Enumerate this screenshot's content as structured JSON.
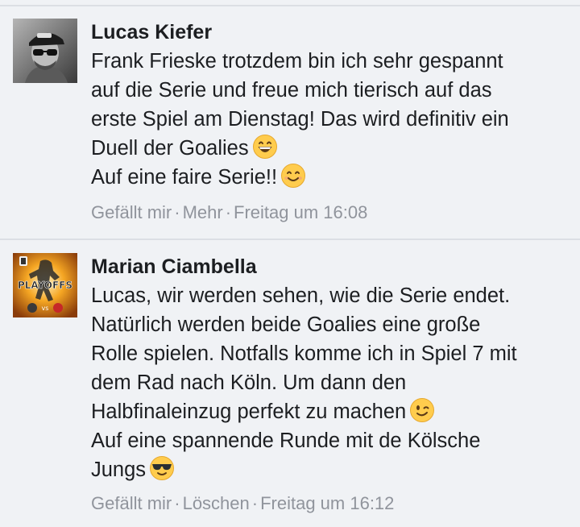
{
  "comments": [
    {
      "author": "Lucas Kiefer",
      "lines": [
        "Frank Frieske trotzdem bin ich sehr gespannt",
        "auf die Serie und freue mich tierisch auf das",
        "erste Spiel am Dienstag! Das wird definitiv ein",
        "Duell der Goalies",
        "Auf eine faire Serie!!"
      ],
      "emojis": [
        "grinning-face-icon",
        "smiling-face-icon"
      ],
      "actions": {
        "like": "Gefällt mir",
        "second": "Mehr",
        "time": "Freitag um 16:08"
      }
    },
    {
      "author": "Marian Ciambella",
      "lines": [
        "Lucas, wir werden sehen, wie die Serie endet.",
        "Natürlich werden beide Goalies eine große",
        "Rolle spielen. Notfalls komme ich in Spiel 7 mit",
        "dem Rad nach Köln. Um dann den",
        "Halbfinaleinzug perfekt zu machen",
        "Auf eine spannende Runde mit de Kölsche",
        "Jungs"
      ],
      "emojis": [
        "winking-face-icon",
        "sunglasses-face-icon"
      ],
      "actions": {
        "like": "Gefällt mir",
        "second": "Löschen",
        "time": "Freitag um 16:12"
      },
      "avatar_text": "PLAYOFFS"
    }
  ],
  "separator": "·",
  "colors": {
    "background": "#f0f2f5",
    "text": "#1c1e21",
    "meta": "#90949c",
    "emoji_yellow": "#ffcc4d"
  }
}
